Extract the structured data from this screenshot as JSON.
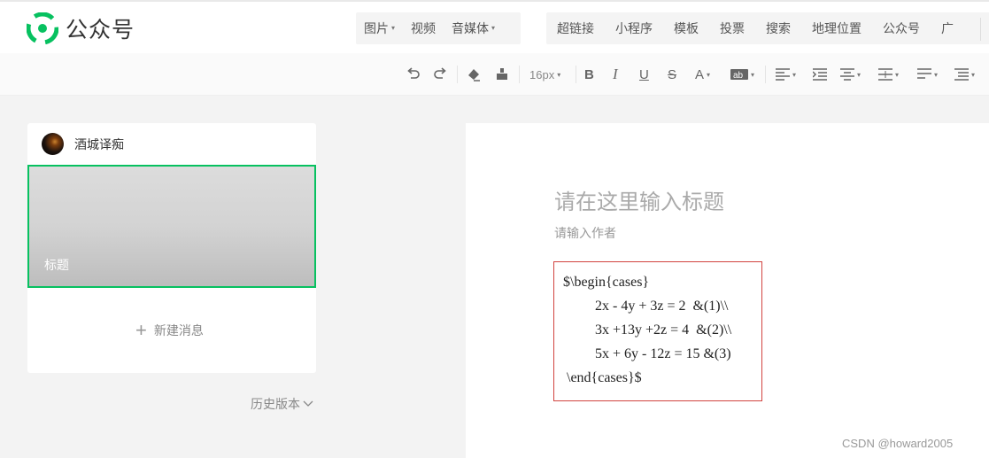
{
  "header": {
    "app_title": "公众号",
    "menu_group1": [
      {
        "label": "图片",
        "dropdown": true
      },
      {
        "label": "视频",
        "dropdown": false
      },
      {
        "label": "音媒体",
        "dropdown": true
      }
    ],
    "menu_group2": [
      "超链接",
      "小程序",
      "模板",
      "投票",
      "搜索",
      "地理位置",
      "公众号",
      "广"
    ]
  },
  "toolbar": {
    "font_size": "16px",
    "icons": [
      "undo-icon",
      "redo-icon",
      "eraser-icon",
      "format-brush-icon",
      "bold-icon",
      "italic-icon",
      "underline-icon",
      "strikethrough-icon",
      "font-color-icon",
      "background-color-icon",
      "align-left-icon",
      "indent-icon",
      "line-height-icon",
      "paragraph-spacing-icon",
      "justify-icon",
      "list-icon"
    ]
  },
  "left_panel": {
    "author_name": "酒城译痴",
    "cover_title": "标题",
    "new_message": "新建消息",
    "history": "历史版本"
  },
  "editor": {
    "title_placeholder": "请在这里输入标题",
    "author_placeholder": "请输入作者",
    "formula_lines": [
      "$\\begin{cases}",
      "2x - 4y + 3z = 2  &(1)\\\\",
      "3x +13y +2z = 4  &(2)\\\\",
      "5x + 6y - 12z = 15 &(3)",
      "\\end{cases}$"
    ]
  },
  "watermark": "CSDN @howard2005",
  "colors": {
    "accent": "#07c160",
    "formula_border": "#d2433f",
    "background": "#f3f3f3"
  }
}
